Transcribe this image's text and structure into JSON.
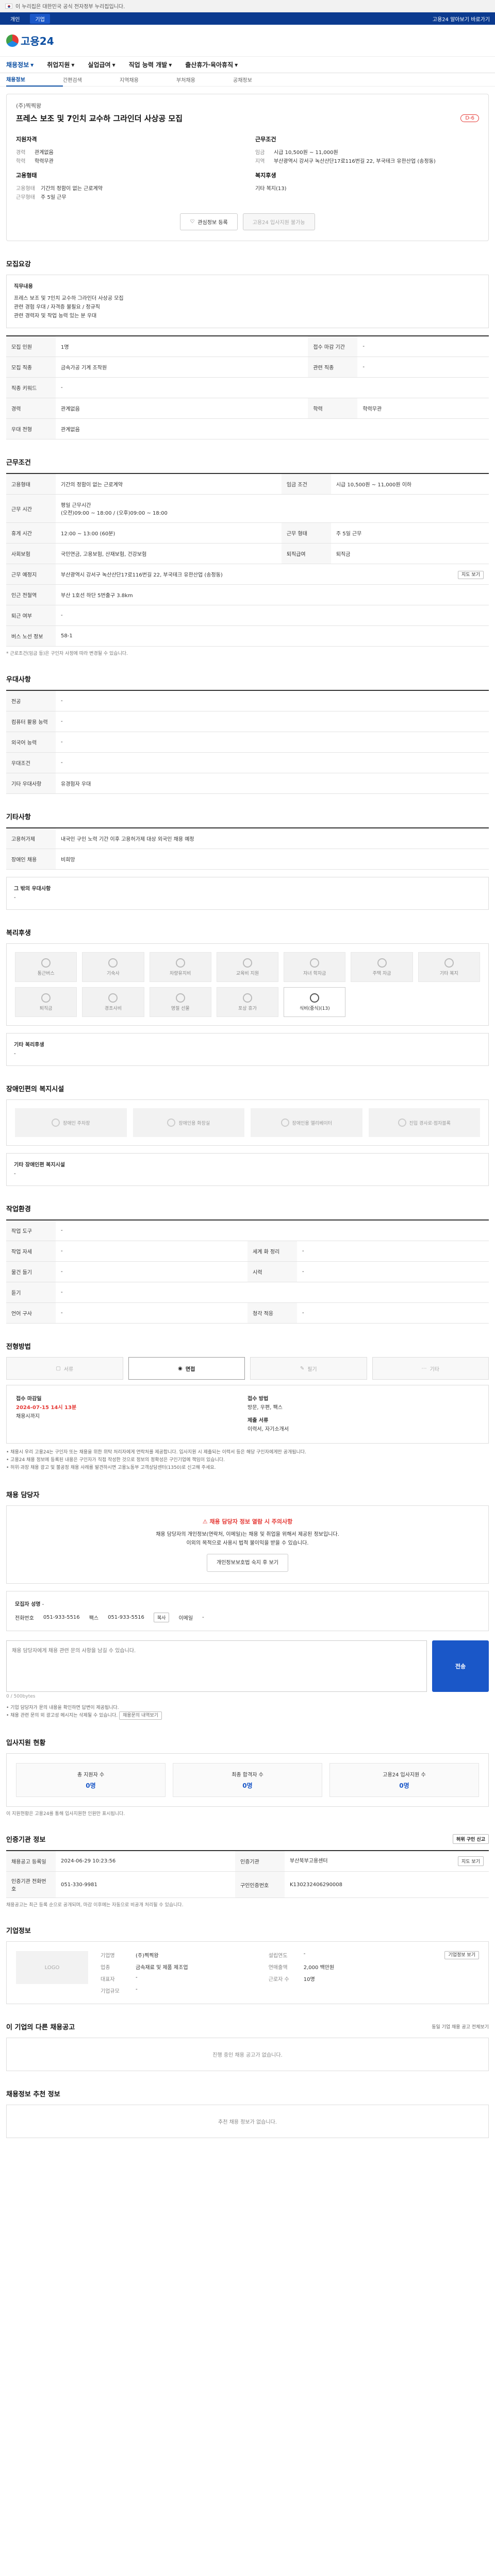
{
  "gov_banner": {
    "text": "이 누리집은 대한민국 공식 전자정부 누리집입니다."
  },
  "topbar": {
    "tabs": [
      "개인",
      "기업"
    ],
    "right": "고용24 알아보기 바로가기"
  },
  "header": {
    "logo_text": "고용24"
  },
  "gnb": [
    "채용정보",
    "취업지원",
    "실업급여",
    "직업 능력 개발",
    "출산휴가·육아휴직"
  ],
  "subnav": [
    "채용정보",
    "간편검색",
    "지역채용",
    "부처채용",
    "공채정보"
  ],
  "job": {
    "company": "(주)찍찍왕",
    "title": "프레스 보조 및 7인치 교수하 그라인더 사상공 모집",
    "dday": "D-6",
    "summary_left_title": "지원자격",
    "summary_left": [
      {
        "k": "경력",
        "v": "관계없음"
      },
      {
        "k": "학력",
        "v": "학력무관"
      }
    ],
    "summary_right_title": "근무조건",
    "summary_right": [
      {
        "k": "임금",
        "v": "시급 10,500원 ~ 11,000원"
      },
      {
        "k": "지역",
        "v": "부산광역시 강서구 녹산산단17로116번길 22, 부국테크 유한산업 (송정동)"
      }
    ],
    "summary_left2_title": "고용형태",
    "summary_left2": [
      {
        "k": "고용형태",
        "v": "기간의 정함이 없는 근로계약"
      },
      {
        "k": "근무형태",
        "v": "주 5일 근무"
      }
    ],
    "summary_right2_title": "복지후생",
    "summary_right2": [
      {
        "k": "",
        "v": "기타 복지(13)"
      }
    ],
    "btn_interest": "관심정보 등록",
    "btn_apply": "고용24 입사지원 불가능"
  },
  "recruit": {
    "title": "모집요강",
    "desc_title": "직무내용",
    "desc": "프레스 보조 및 7인치 교수하 그라인더 사상공 모집\n관련 경험 우대 / 자격증 불필요 / 정규직\n관련 경력자 및 작업 능력 있는 분 우대",
    "rows": [
      {
        "k": "모집 인원",
        "v": "1명",
        "k2": "접수 마감 기간",
        "v2": "-"
      },
      {
        "k": "모집 직종",
        "v": "금속가공 기계 조작원",
        "k2": "관련 직종",
        "v2": "-"
      },
      {
        "k": "직종 키워드",
        "v": "-",
        "k2": "",
        "v2": ""
      },
      {
        "k": "경력",
        "v": "관계없음",
        "k2": "학력",
        "v2": "학력무관"
      },
      {
        "k": "우대 전형",
        "v": "관계없음",
        "k2": "",
        "v2": ""
      }
    ]
  },
  "conditions": {
    "title": "근무조건",
    "rows": [
      {
        "k": "고용형태",
        "v": "기간의 정함이 없는 근로계약",
        "k2": "임금 조건",
        "v2": "시급 10,500원 ~ 11,000원 이하"
      },
      {
        "k": "근무 시간",
        "v": "평일 근무시간\n(오전)09:00 ~ 18:00 / (오후)09:00 ~ 18:00",
        "k2": "",
        "v2": ""
      },
      {
        "k": "휴게 시간",
        "v": "12:00 ~ 13:00 (60분)",
        "k2": "근무 형태",
        "v2": "주 5일 근무"
      },
      {
        "k": "사회보험",
        "v": "국민연금, 고용보험, 산재보험, 건강보험",
        "k2": "퇴직급여",
        "v2": "퇴직금"
      },
      {
        "k": "근무 예정지",
        "v": "부산광역시 강서구 녹산산단17로116번길 22, 부국테크 유한산업 (송정동)",
        "k2": "",
        "v2": "지도 보기"
      },
      {
        "k": "인근 전철역",
        "v": "부산 1호선 하단 5번출구 3.8km",
        "k2": "",
        "v2": ""
      },
      {
        "k": "퇴근 여부",
        "v": "-",
        "k2": "",
        "v2": ""
      },
      {
        "k": "버스 노선 정보",
        "v": "58-1",
        "k2": "",
        "v2": ""
      }
    ],
    "note": "* 근로조건(임금 등)은 구인자 사정에 따라 변경될 수 있습니다."
  },
  "preference": {
    "title": "우대사항",
    "rows": [
      {
        "k": "전공",
        "v": "-"
      },
      {
        "k": "컴퓨터 활용 능력",
        "v": "-"
      },
      {
        "k": "외국어 능력",
        "v": "-"
      },
      {
        "k": "우대조건",
        "v": "-"
      },
      {
        "k": "기타 우대사항",
        "v": "유경험자 우대"
      }
    ]
  },
  "other": {
    "title": "기타사항",
    "rows": [
      {
        "k": "고용허가제",
        "v": "내국인 구인 노력 기간 이후 고용허가제 대상 외국인 채용 예정"
      },
      {
        "k": "장애인 채용",
        "v": "비희망"
      }
    ],
    "extra_title": "그 밖의 우대사항",
    "extra": "-"
  },
  "benefits": {
    "title": "복리후생",
    "items": [
      {
        "label": "통근버스",
        "on": false
      },
      {
        "label": "기숙사",
        "on": false
      },
      {
        "label": "차량유지비",
        "on": false
      },
      {
        "label": "교육비 지원",
        "on": false
      },
      {
        "label": "자녀 학자금",
        "on": false
      },
      {
        "label": "주택 자금",
        "on": false
      },
      {
        "label": "기타 복지",
        "on": false
      },
      {
        "label": "퇴직금",
        "on": false
      },
      {
        "label": "경조사비",
        "on": false
      },
      {
        "label": "명절 선물",
        "on": false
      },
      {
        "label": "포상 휴가",
        "on": false
      },
      {
        "label": "식비(중식)(13)",
        "on": true
      }
    ],
    "other_title": "기타 복리후생",
    "other": "-"
  },
  "facilities": {
    "title": "장애인편의 복지시설",
    "items": [
      "장애인 주차장",
      "장애인용 화장실",
      "장애인용 엘리베이터",
      "진입 경사로·점자블록"
    ],
    "other_title": "기타 장애인편 복지시설",
    "other": "-"
  },
  "workenv": {
    "title": "작업환경",
    "rows": [
      {
        "k": "작업 도구",
        "v": "-",
        "k2": "",
        "v2": ""
      },
      {
        "k": "작업 자세",
        "v": "-",
        "k2": "세계 화 정리",
        "v2": "-"
      },
      {
        "k": "물건 들기",
        "v": "-",
        "k2": "시력",
        "v2": "-"
      },
      {
        "k": "듣기",
        "v": "-",
        "k2": "",
        "v2": ""
      },
      {
        "k": "언어 구사",
        "v": "-",
        "k2": "청각 적응",
        "v2": "-"
      }
    ]
  },
  "method": {
    "title": "전형방법",
    "tabs": [
      "서류",
      "면접",
      "필기",
      "기타"
    ],
    "active_index": 1,
    "deadline_label": "접수 마감일",
    "deadline": "2024-07-15 14시 13분",
    "deadline_sub": "채용시까지",
    "process_label": "접수 방법",
    "process": "방문, 우편, 팩스",
    "docs_label": "제출 서류",
    "docs": "이력서, 자기소개서",
    "bullets": [
      "채용시 우리 고용24는 구인자 또는 채용을 위한 위탁 처리자에게 연락처를 제공합니다. 입사지원 시 제출되는 이력서 등은 해당 구인자에게만 공개됩니다.",
      "고용24 채용 정보에 등록된 내용은 구인자가 직접 작성한 것으로 정보의 정확성은 구인기업에 책임이 있습니다.",
      "허위·과장 채용 광고 및 불공정 채용 사례를 발견하시면 고용노동부 고객상담센터(1350)로 신고해 주세요."
    ]
  },
  "contact": {
    "title": "채용 담당자",
    "alert_title": "채용 담당자 정보 열람 시 주의사항",
    "alert_body": "채용 담당자의 개인정보(연락처, 이메일)는 채용 및 취업을 위해서 제공된 정보입니다.\n이외의 목적으로 사용시 법적 불이익을 받을 수 있습니다.",
    "alert_btn": "개인정보보호법 숙지 후 보기",
    "manager_label": "모집자 성명",
    "manager": "-",
    "phone_label": "전화번호",
    "phone": "051-933-5516",
    "fax_label": "팩스",
    "fax": "051-933-5516",
    "email_label": "이메일",
    "email": "-",
    "copy": "복사",
    "send_placeholder": "채용 담당자에게 채용 관련 문의 사항을 남길 수 있습니다.",
    "send_btn": "전송",
    "counter": "0 / 500bytes",
    "inquiry_bullets": [
      "기업 담당자가 문의 내용을 확인하면 답변이 제공됩니다.",
      "채용 관련 문의 외 광고성 메시지는 삭제될 수 있습니다."
    ],
    "inquiry_btn": "채용문의 내역보기"
  },
  "applicants": {
    "title": "입사지원 현황",
    "items": [
      {
        "label": "총 지원자 수",
        "value": "0명"
      },
      {
        "label": "최종 합격자 수",
        "value": "0명"
      },
      {
        "label": "고용24 입사지원 수",
        "value": "0명"
      }
    ],
    "note": "이 지원현황은 고용24를 통해 입사지원한 인원만 표시됩니다."
  },
  "auth": {
    "title": "인증기관 정보",
    "rows": [
      {
        "k": "채용공고 등록일",
        "v": "2024-06-29 10:23:56",
        "k2": "인증기관",
        "v2": "부산북부고용센터"
      },
      {
        "k": "인증기관 전화번호",
        "v": "051-330-9981",
        "k2": "구인인증번호",
        "v2": "K130232406290008"
      }
    ],
    "btn_map": "지도 보기",
    "btn_report": "허위 구인 신고",
    "note": "채용공고는 최근 등록 순으로 공개되며, 마감 이후에는 자동으로 비공개 처리될 수 있습니다."
  },
  "corp": {
    "title": "기업정보",
    "logo": "LOGO",
    "rows": [
      {
        "k": "기업명",
        "v": "(주)찍찍왕",
        "k2": "설립연도",
        "v2": "-"
      },
      {
        "k": "업종",
        "v": "금속재료 및 제품 제조업",
        "k2": "연매출액",
        "v2": "2,000 백만원"
      },
      {
        "k": "대표자",
        "v": "-",
        "k2": "근로자 수",
        "v2": "10명"
      },
      {
        "k": "기업규모",
        "v": "-",
        "k2": "",
        "v2": ""
      }
    ],
    "btn": "기업정보 보기"
  },
  "same_company": {
    "title": "이 기업의 다른 채용공고",
    "link": "동일 기업 채용 공고 전체보기",
    "empty": "진행 중인 채용 공고가 없습니다."
  },
  "recommend": {
    "title": "채용정보 추천 정보",
    "empty": "추천 채용 정보가 없습니다."
  }
}
